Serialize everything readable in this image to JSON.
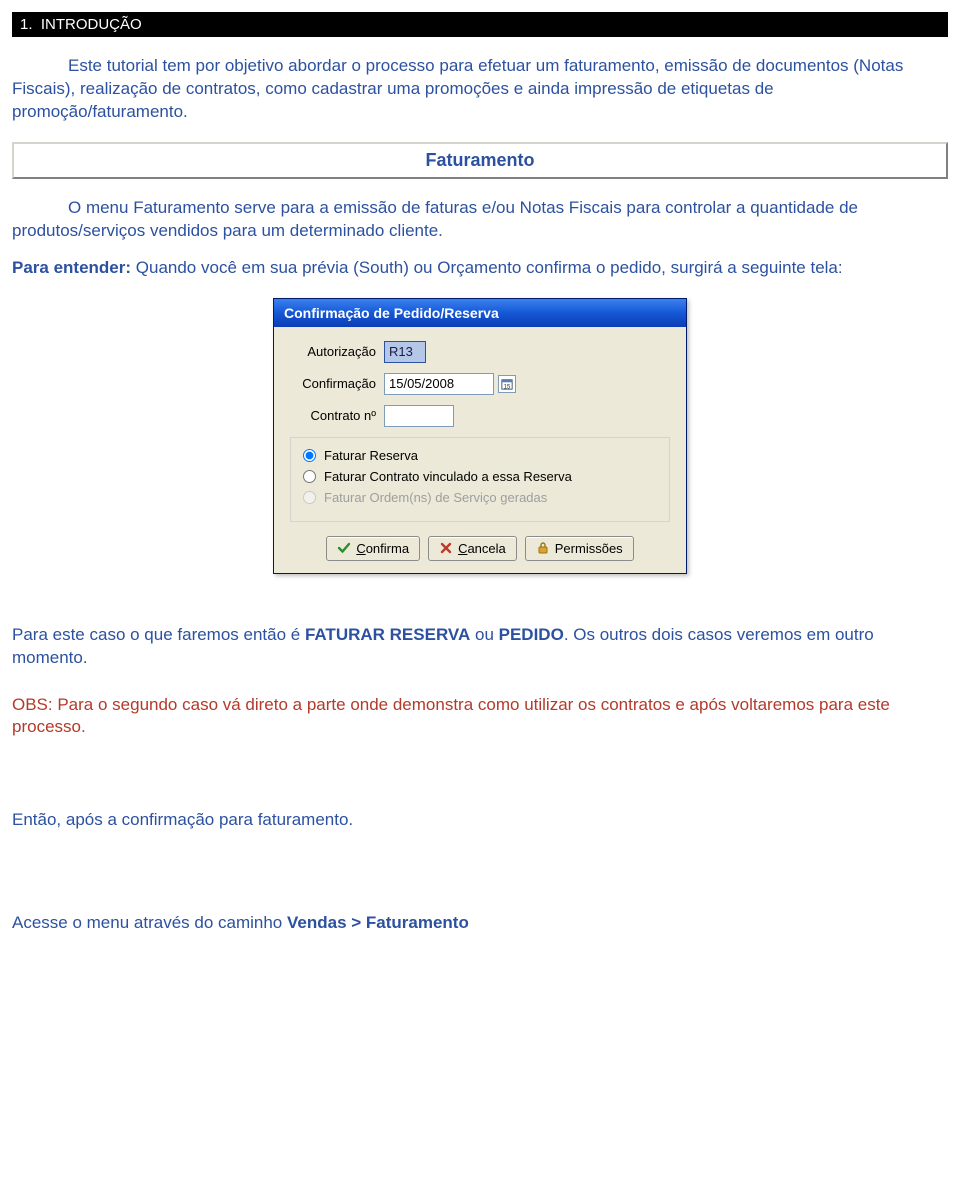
{
  "section": {
    "number": "1.",
    "title": "INTRODUÇÃO"
  },
  "intro_para": "Este tutorial tem por objetivo abordar o processo para efetuar um faturamento, emissão de documentos (Notas Fiscais), realização de contratos, como cadastrar uma promoções e ainda impressão de etiquetas de promoção/faturamento.",
  "callout_title": "Faturamento",
  "para2": "O menu Faturamento serve para a emissão de faturas e/ou Notas Fiscais para controlar a quantidade de produtos/serviços vendidos para um determinado cliente.",
  "entender_lead": "Para entender:",
  "entender_rest": " Quando você em sua prévia (South) ou Orçamento confirma o pedido, surgirá a seguinte tela:",
  "dialog": {
    "title": "Confirmação de Pedido/Reserva",
    "labels": {
      "auth": "Autorização",
      "conf": "Confirmação",
      "contrato": "Contrato nº"
    },
    "values": {
      "auth": "R13",
      "conf": "15/05/2008",
      "contrato": ""
    },
    "radios": {
      "r1": "Faturar Reserva",
      "r2": "Faturar Contrato vinculado a essa Reserva",
      "r3": "Faturar Ordem(ns) de Serviço geradas"
    },
    "buttons": {
      "confirma": "Confirma",
      "cancela": "Cancela",
      "permissoes": "Permissões"
    }
  },
  "after": {
    "p1a": "Para este caso o que faremos então é ",
    "bold1": "FATURAR RESERVA",
    "mid": " ou ",
    "bold2": "PEDIDO",
    "p1b": ". Os outros dois casos veremos em outro momento."
  },
  "obs": "OBS: Para o segundo caso vá direto a parte onde demonstra como utilizar os contratos e após voltaremos para este processo.",
  "entao": "Então, após a confirmação para faturamento.",
  "access": {
    "pre": "Acesse o menu através do caminho ",
    "bold": "Vendas > Faturamento"
  }
}
